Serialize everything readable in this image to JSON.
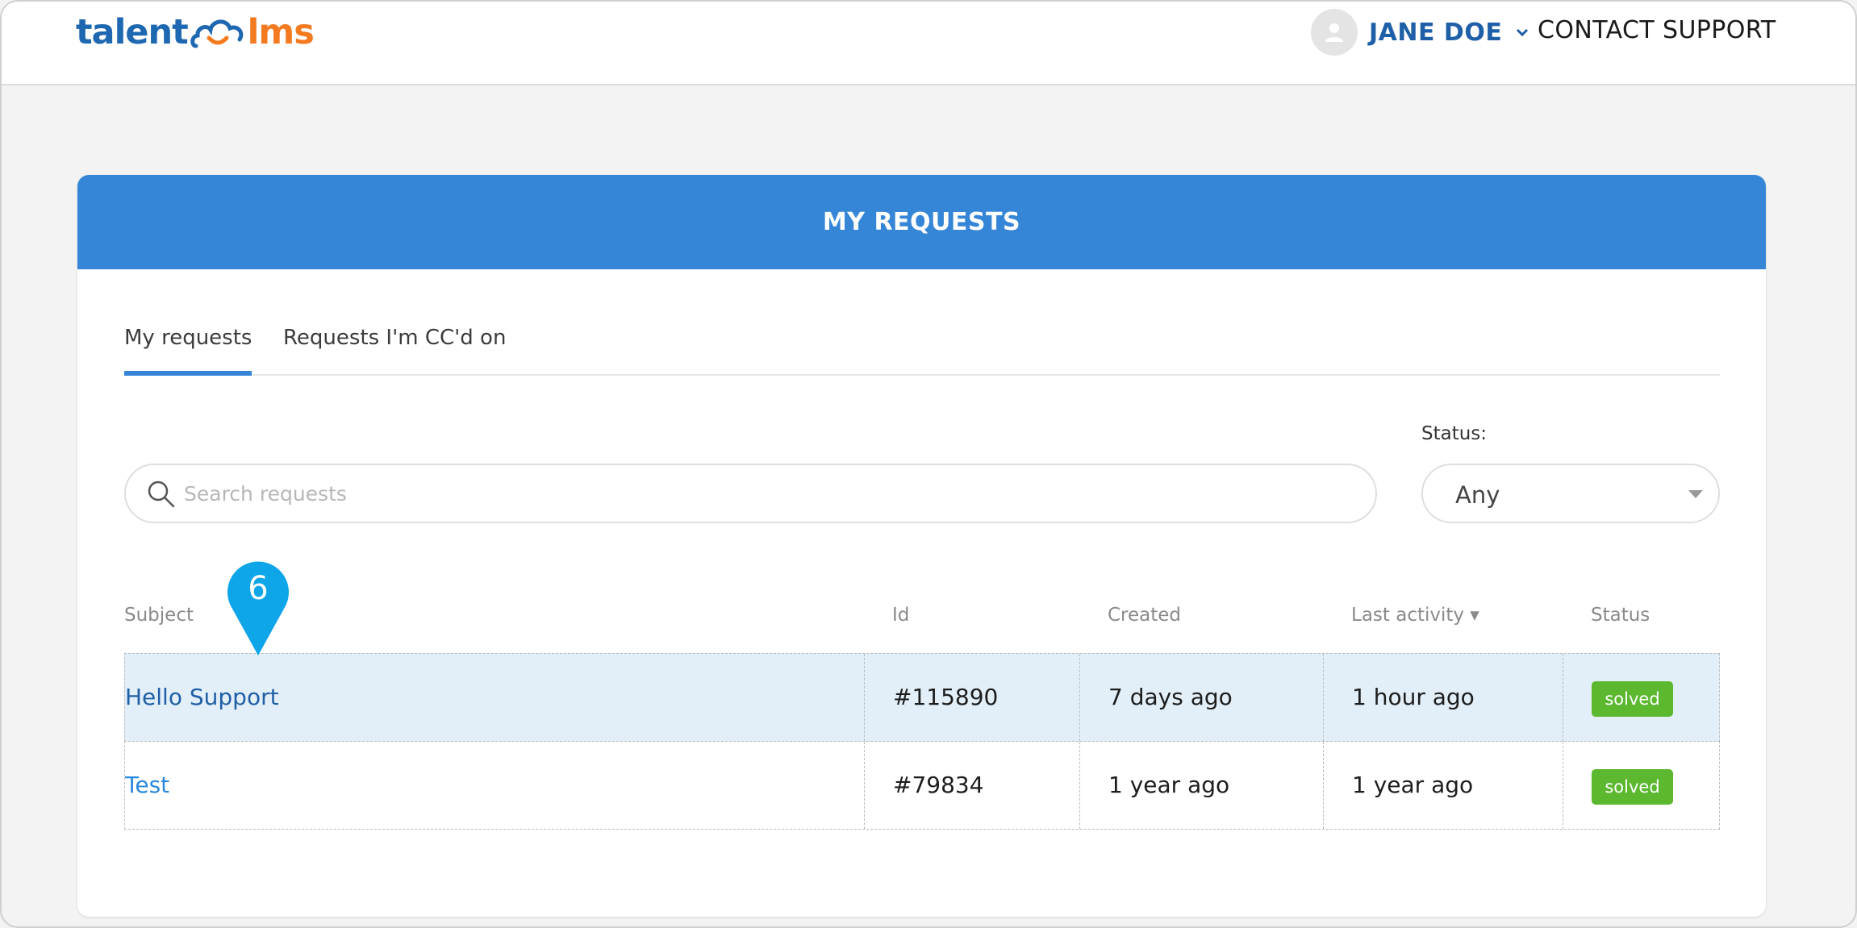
{
  "header": {
    "logo": {
      "talent": "talent",
      "lms": "lms"
    },
    "user_name": "JANE DOE",
    "contact_label": "CONTACT SUPPORT"
  },
  "card": {
    "title": "MY REQUESTS",
    "tabs": [
      {
        "label": "My requests",
        "active": true
      },
      {
        "label": "Requests I'm CC'd on",
        "active": false
      }
    ],
    "search": {
      "placeholder": "Search requests",
      "value": ""
    },
    "status_filter": {
      "label": "Status:",
      "value": "Any"
    }
  },
  "table": {
    "columns": [
      "Subject",
      "Id",
      "Created",
      "Last activity ▾",
      "Status"
    ],
    "rows": [
      {
        "subject": "Hello Support",
        "id": "#115890",
        "created": "7 days ago",
        "last_activity": "1 hour ago",
        "status": "solved"
      },
      {
        "subject": "Test",
        "id": "#79834",
        "created": "1 year ago",
        "last_activity": "1 year ago",
        "status": "solved"
      }
    ]
  },
  "step_marker": {
    "number": "6"
  },
  "colors": {
    "brand_blue": "#3586d6",
    "logo_blue": "#1e67b1",
    "logo_orange": "#f47a20",
    "status_solved": "#5bb82f",
    "marker": "#0ea5e9",
    "row_highlight": "#e3eff8"
  }
}
